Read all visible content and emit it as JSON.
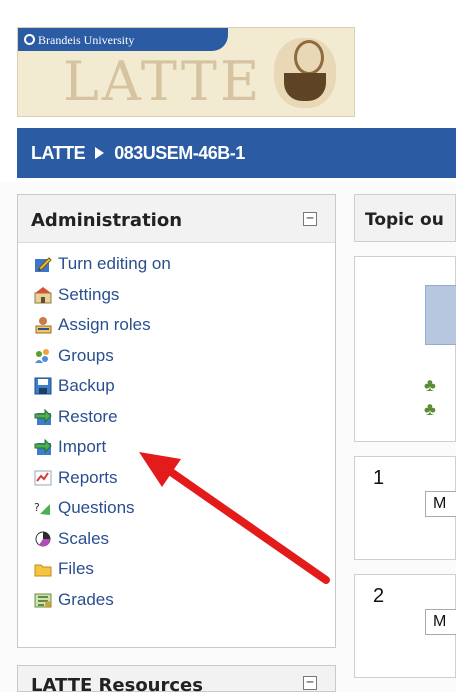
{
  "brand": {
    "university": "Brandeis University",
    "app_name": "LATTE"
  },
  "breadcrumb": {
    "home": "LATTE",
    "course": "083USEM-46B-1"
  },
  "sidebar": {
    "title": "Administration",
    "collapse": "−",
    "items": [
      {
        "label": "Turn editing on",
        "icon": "edit-icon"
      },
      {
        "label": "Settings",
        "icon": "settings-icon"
      },
      {
        "label": "Assign roles",
        "icon": "assign-roles-icon"
      },
      {
        "label": "Groups",
        "icon": "groups-icon"
      },
      {
        "label": "Backup",
        "icon": "backup-icon"
      },
      {
        "label": "Restore",
        "icon": "restore-icon"
      },
      {
        "label": "Import",
        "icon": "import-icon"
      },
      {
        "label": "Reports",
        "icon": "reports-icon"
      },
      {
        "label": "Questions",
        "icon": "questions-icon"
      },
      {
        "label": "Scales",
        "icon": "scales-icon"
      },
      {
        "label": "Files",
        "icon": "folder-icon"
      },
      {
        "label": "Grades",
        "icon": "grades-icon"
      }
    ]
  },
  "main": {
    "topic_tab": "Topic ou",
    "sections": [
      {
        "number": "1",
        "select": "M"
      },
      {
        "number": "2",
        "select": "M"
      }
    ]
  },
  "resources": {
    "title": "LATTE Resources",
    "collapse": "−"
  },
  "colors": {
    "nav_blue": "#2b5ba2",
    "link_blue": "#2a4f8f",
    "annotation_red": "#e31b1b"
  }
}
